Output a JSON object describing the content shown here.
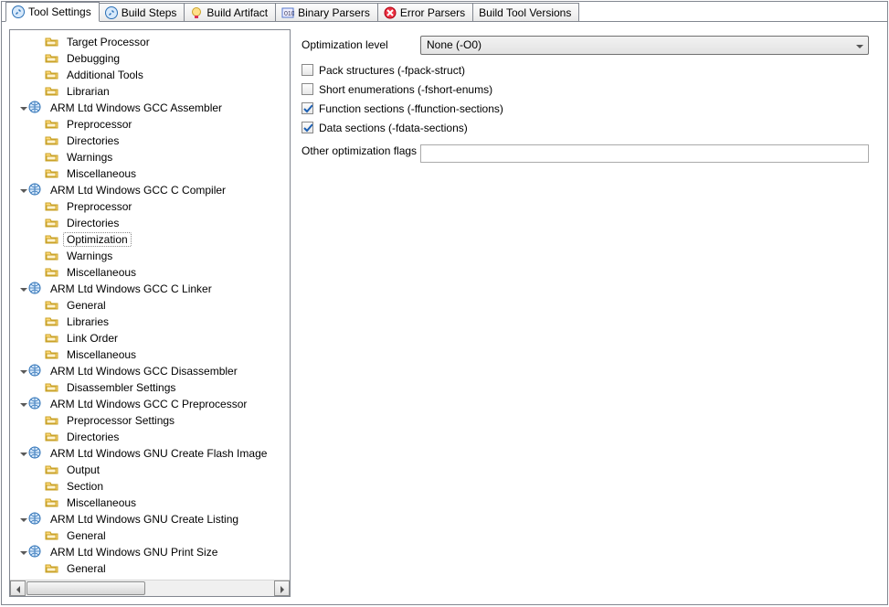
{
  "tabs": [
    {
      "icon": "wrench",
      "label": "Tool Settings",
      "active": true
    },
    {
      "icon": "wrench",
      "label": "Build Steps"
    },
    {
      "icon": "medal",
      "label": "Build Artifact"
    },
    {
      "icon": "binary",
      "label": "Binary Parsers"
    },
    {
      "icon": "error",
      "label": "Error Parsers"
    },
    {
      "icon": "none",
      "label": "Build Tool Versions"
    }
  ],
  "tree": [
    {
      "d": 1,
      "t": "t",
      "e": null,
      "label": "Target Processor"
    },
    {
      "d": 1,
      "t": "t",
      "e": null,
      "label": "Debugging"
    },
    {
      "d": 1,
      "t": "t",
      "e": null,
      "label": "Additional Tools"
    },
    {
      "d": 1,
      "t": "t",
      "e": null,
      "label": "Librarian"
    },
    {
      "d": 0,
      "t": "g",
      "e": true,
      "label": "ARM Ltd Windows GCC Assembler"
    },
    {
      "d": 1,
      "t": "t",
      "e": null,
      "label": "Preprocessor"
    },
    {
      "d": 1,
      "t": "t",
      "e": null,
      "label": "Directories"
    },
    {
      "d": 1,
      "t": "t",
      "e": null,
      "label": "Warnings"
    },
    {
      "d": 1,
      "t": "t",
      "e": null,
      "label": "Miscellaneous"
    },
    {
      "d": 0,
      "t": "g",
      "e": true,
      "label": "ARM Ltd Windows GCC C Compiler"
    },
    {
      "d": 1,
      "t": "t",
      "e": null,
      "label": "Preprocessor"
    },
    {
      "d": 1,
      "t": "t",
      "e": null,
      "label": "Directories"
    },
    {
      "d": 1,
      "t": "t",
      "e": null,
      "label": "Optimization",
      "sel": true
    },
    {
      "d": 1,
      "t": "t",
      "e": null,
      "label": "Warnings"
    },
    {
      "d": 1,
      "t": "t",
      "e": null,
      "label": "Miscellaneous"
    },
    {
      "d": 0,
      "t": "g",
      "e": true,
      "label": "ARM Ltd Windows GCC C Linker"
    },
    {
      "d": 1,
      "t": "t",
      "e": null,
      "label": "General"
    },
    {
      "d": 1,
      "t": "t",
      "e": null,
      "label": "Libraries"
    },
    {
      "d": 1,
      "t": "t",
      "e": null,
      "label": "Link Order"
    },
    {
      "d": 1,
      "t": "t",
      "e": null,
      "label": "Miscellaneous"
    },
    {
      "d": 0,
      "t": "g",
      "e": true,
      "label": "ARM Ltd Windows GCC Disassembler"
    },
    {
      "d": 1,
      "t": "t",
      "e": null,
      "label": "Disassembler Settings"
    },
    {
      "d": 0,
      "t": "g",
      "e": true,
      "label": "ARM Ltd Windows GCC C Preprocessor"
    },
    {
      "d": 1,
      "t": "t",
      "e": null,
      "label": "Preprocessor Settings"
    },
    {
      "d": 1,
      "t": "t",
      "e": null,
      "label": "Directories"
    },
    {
      "d": 0,
      "t": "g",
      "e": true,
      "label": "ARM Ltd Windows GNU Create Flash Image"
    },
    {
      "d": 1,
      "t": "t",
      "e": null,
      "label": "Output"
    },
    {
      "d": 1,
      "t": "t",
      "e": null,
      "label": "Section"
    },
    {
      "d": 1,
      "t": "t",
      "e": null,
      "label": "Miscellaneous"
    },
    {
      "d": 0,
      "t": "g",
      "e": true,
      "label": "ARM Ltd Windows GNU Create Listing"
    },
    {
      "d": 1,
      "t": "t",
      "e": null,
      "label": "General"
    },
    {
      "d": 0,
      "t": "g",
      "e": true,
      "label": "ARM Ltd Windows GNU Print Size"
    },
    {
      "d": 1,
      "t": "t",
      "e": null,
      "label": "General"
    }
  ],
  "pane": {
    "optlvl_label": "Optimization level",
    "optlvl_value": "None (-O0)",
    "checks": [
      {
        "label": "Pack structures (-fpack-struct)",
        "on": false
      },
      {
        "label": "Short enumerations (-fshort-enums)",
        "on": false
      },
      {
        "label": "Function sections (-ffunction-sections)",
        "on": true
      },
      {
        "label": "Data sections (-fdata-sections)",
        "on": true
      }
    ],
    "otherflags_label": "Other optimization flags",
    "otherflags_value": ""
  }
}
